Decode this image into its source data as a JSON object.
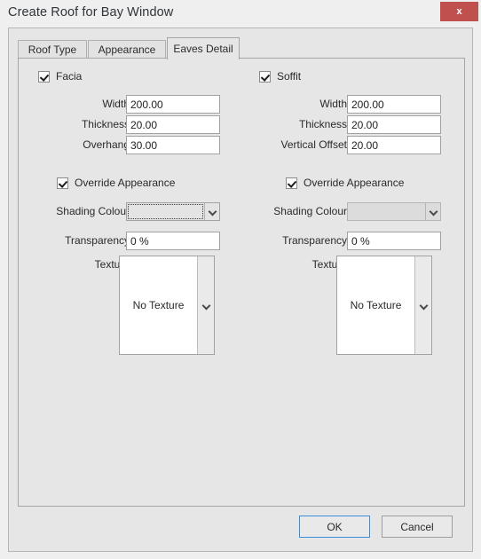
{
  "window": {
    "title": "Create Roof for Bay Window",
    "close_label": "x",
    "close_icon": "close-icon",
    "accent_color": "#c0504d",
    "default_button_border": "#3a8ddb",
    "background": "#efefef"
  },
  "tabs": [
    {
      "id": "roof-type",
      "label": "Roof Type",
      "active": false
    },
    {
      "id": "appearance",
      "label": "Appearance",
      "active": false
    },
    {
      "id": "eaves",
      "label": "Eaves Detail",
      "active": true
    }
  ],
  "panels": {
    "facia": {
      "group_label": "Facia",
      "group_checked": true,
      "fields": [
        {
          "label": "Width",
          "value": "200.00"
        },
        {
          "label": "Thickness",
          "value": "20.00"
        },
        {
          "label": "Overhang",
          "value": "30.00"
        }
      ],
      "override": {
        "label": "Override Appearance",
        "checked": true
      },
      "shading_colour": {
        "label": "Shading Colour",
        "value": "",
        "focused": true,
        "disabled": false,
        "arrow_icon": "chevron-down-icon"
      },
      "transparency": {
        "label": "Transparency",
        "value": "0 %"
      },
      "texture": {
        "label": "Texture",
        "value": "No Texture",
        "arrow_icon": "chevron-down-icon"
      }
    },
    "soffit": {
      "group_label": "Soffit",
      "group_checked": true,
      "fields": [
        {
          "label": "Width",
          "value": "200.00"
        },
        {
          "label": "Thickness",
          "value": "20.00"
        },
        {
          "label": "Vertical Offset",
          "value": "20.00"
        }
      ],
      "override": {
        "label": "Override Appearance",
        "checked": true
      },
      "shading_colour": {
        "label": "Shading Colour",
        "value": "",
        "focused": false,
        "disabled": true,
        "arrow_icon": "chevron-down-icon"
      },
      "transparency": {
        "label": "Transparency",
        "value": "0 %"
      },
      "texture": {
        "label": "Texture",
        "value": "No Texture",
        "arrow_icon": "chevron-down-icon"
      }
    }
  },
  "footer": {
    "ok_label": "OK",
    "cancel_label": "Cancel"
  }
}
